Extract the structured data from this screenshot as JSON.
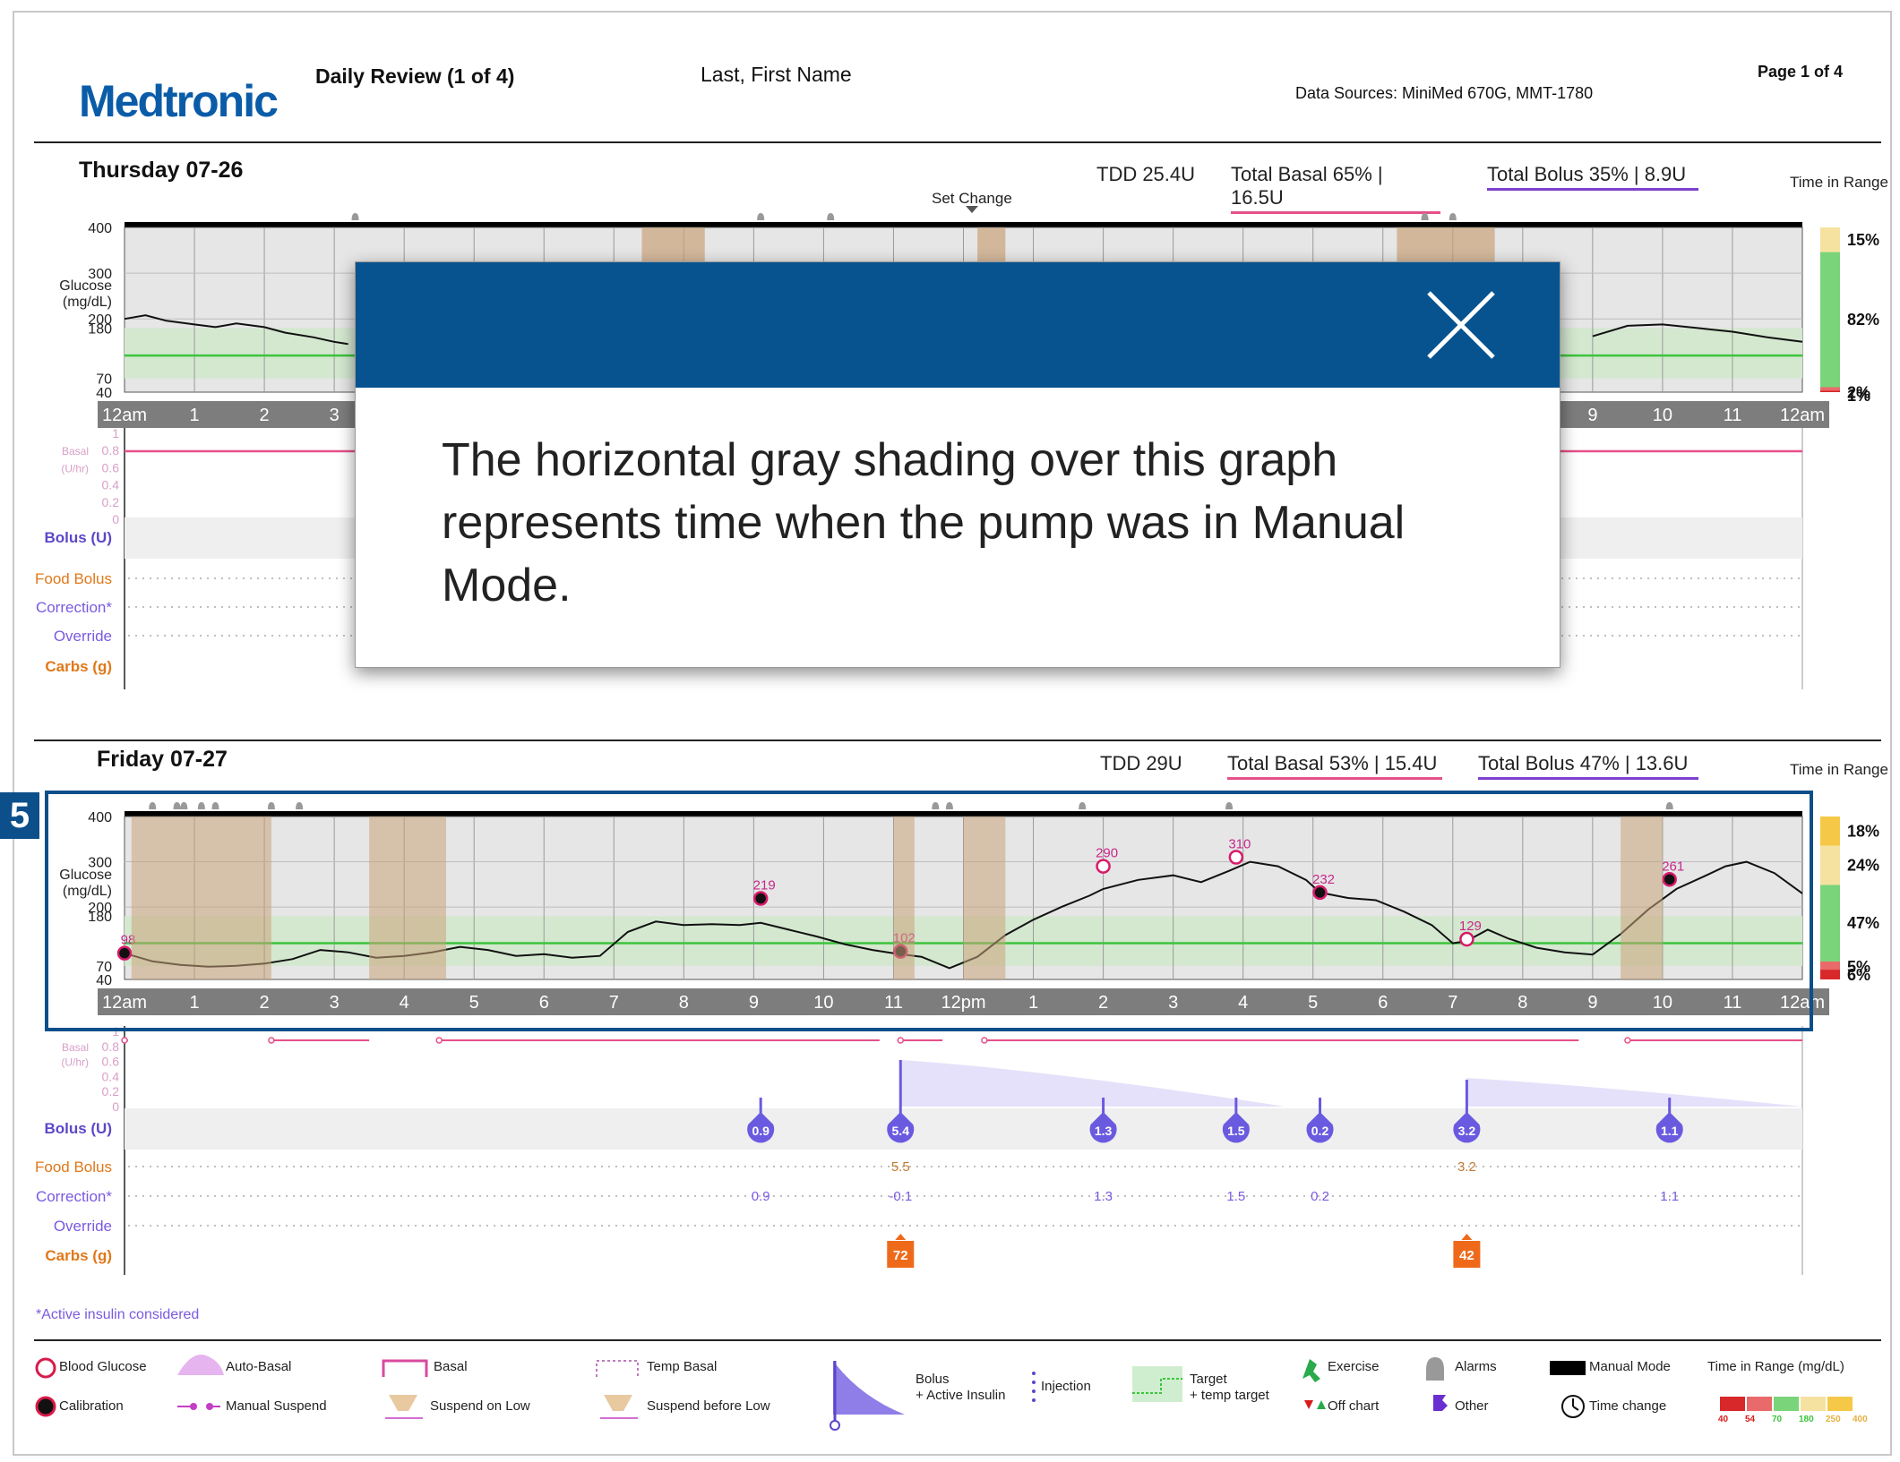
{
  "header": {
    "logo": "Medtronic",
    "report_title": "Daily Review (1 of 4)",
    "patient_name": "Last, First Name",
    "data_sources": "Data Sources: MiniMed 670G, MMT-1780",
    "page_label": "Page 1 of 4"
  },
  "colors": {
    "brand_blue": "#0b5ca8",
    "overlay_blue": "#06538f",
    "basal_pink": "#e6508a",
    "bolus_purple": "#7e5ee0",
    "target_green": "#3cc43c",
    "carbs_orange": "#ee6a1a"
  },
  "tooltip": {
    "text": "The horizontal gray shading over this graph represents time when the pump was in Manual Mode."
  },
  "callout": {
    "number": "5"
  },
  "footnote": "*Active insulin considered",
  "lane_labels": {
    "basal": "Basal",
    "basal_units": "(U/hr)",
    "bolus": "Bolus (U)",
    "food_bolus": "Food Bolus",
    "correction": "Correction*",
    "override": "Override",
    "carbs": "Carbs (g)",
    "glucose": "Glucose",
    "glucose_units": "(mg/dL)",
    "time_in_range": "Time in Range"
  },
  "y_ticks": [
    "400",
    "300",
    "200",
    "180",
    "70",
    "40"
  ],
  "basal_ticks": [
    "1",
    "0.8",
    "0.6",
    "0.4",
    "0.2",
    "0"
  ],
  "x_ticks": [
    "12am",
    "1",
    "2",
    "3",
    "4",
    "5",
    "6",
    "7",
    "8",
    "9",
    "10",
    "11",
    "12pm",
    "1",
    "2",
    "3",
    "4",
    "5",
    "6",
    "7",
    "8",
    "9",
    "10",
    "11",
    "12am"
  ],
  "day1": {
    "title": "Thursday 07-26",
    "tdd": "TDD 25.4U",
    "basal": "Total Basal 65% | 16.5U",
    "bolus": "Total Bolus 35% | 8.9U",
    "set_change": "Set Change",
    "tir": [
      "15%",
      "82%",
      "2%",
      "1%"
    ]
  },
  "day2": {
    "title": "Friday 07-27",
    "tdd": "TDD 29U",
    "basal": "Total Basal 53% | 15.4U",
    "bolus": "Total Bolus 47% | 13.6U",
    "tir": [
      "18%",
      "24%",
      "47%",
      "5%",
      "6%"
    ]
  },
  "legend": {
    "blood_glucose": "Blood Glucose",
    "calibration": "Calibration",
    "auto_basal": "Auto-Basal",
    "manual_suspend": "Manual Suspend",
    "basal": "Basal",
    "suspend_on_low": "Suspend on Low",
    "temp_basal": "Temp Basal",
    "suspend_before_low": "Suspend before Low",
    "bolus": "Bolus",
    "active_insulin": "+ Active Insulin",
    "injection": "Injection",
    "target": "Target",
    "temp_target": "+ temp target",
    "exercise": "Exercise",
    "off_chart": "Off chart",
    "alarms": "Alarms",
    "other": "Other",
    "manual_mode": "Manual Mode",
    "time_change": "Time change",
    "tir_title": "Time in Range (mg/dL)",
    "tir_scale": [
      "40",
      "54",
      "70",
      "180",
      "250",
      "400"
    ]
  },
  "chart_data": [
    {
      "type": "line",
      "title": "Thursday 07-26",
      "xlabel": "",
      "ylabel": "Glucose (mg/dL)",
      "ylim": [
        40,
        400
      ],
      "x_unit": "hour of day",
      "series": [
        {
          "values_x": [
            0,
            0.3,
            0.6,
            1,
            1.3,
            1.6,
            2,
            2.3,
            2.7,
            3,
            3.2
          ],
          "values_y": [
            200,
            208,
            196,
            188,
            182,
            190,
            182,
            170,
            160,
            150,
            145
          ]
        },
        {
          "values_x": [
            21,
            21.5,
            22,
            22.5,
            23,
            23.5,
            24
          ],
          "values_y": [
            162,
            185,
            188,
            180,
            172,
            160,
            150
          ]
        }
      ],
      "target_range": [
        70,
        180
      ],
      "target_line": 120,
      "time_in_range": [
        {
          "label": "15%",
          "value": 15
        },
        {
          "label": "82%",
          "value": 82
        },
        {
          "label": "2%",
          "value": 2
        },
        {
          "label": "1%",
          "value": 1
        }
      ]
    },
    {
      "type": "line",
      "title": "Friday 07-27",
      "xlabel": "",
      "ylabel": "Glucose (mg/dL)",
      "ylim": [
        40,
        400
      ],
      "x_unit": "hour of day",
      "series": [
        {
          "values_x": [
            0,
            0.4,
            0.8,
            1.2,
            1.6,
            2,
            2.4,
            2.8,
            3.2,
            3.6,
            4,
            4.4,
            4.8,
            5.2,
            5.6,
            6,
            6.4,
            6.8,
            7.2,
            7.6,
            8,
            8.4,
            8.8,
            9.1,
            9.5,
            9.9,
            10.3,
            10.7,
            11,
            11.4,
            11.8,
            12.2,
            12.6,
            13,
            13.4,
            13.8,
            14,
            14.5,
            15,
            15.4,
            15.8,
            16.1,
            16.5,
            16.9,
            17.1,
            17.5,
            17.9,
            18.3,
            18.7,
            19,
            19.2,
            19.5,
            19.8,
            20.2,
            20.6,
            21,
            21.4,
            21.8,
            22.2,
            22.6,
            22.9,
            23.2,
            23.6,
            24
          ],
          "values_y": [
            98,
            80,
            72,
            68,
            70,
            75,
            85,
            105,
            100,
            88,
            92,
            100,
            112,
            105,
            92,
            96,
            88,
            92,
            145,
            168,
            160,
            162,
            160,
            165,
            150,
            135,
            118,
            105,
            98,
            90,
            65,
            90,
            138,
            172,
            200,
            225,
            240,
            260,
            270,
            255,
            280,
            300,
            290,
            260,
            232,
            220,
            215,
            190,
            160,
            120,
            125,
            150,
            130,
            110,
            100,
            95,
            140,
            195,
            240,
            268,
            290,
            300,
            275,
            230
          ]
        }
      ],
      "target_range": [
        70,
        180
      ],
      "target_line": 120,
      "bg_markers": [
        {
          "x": 0.0,
          "y": 98,
          "label": "98",
          "kind": "calibration"
        },
        {
          "x": 9.1,
          "y": 219,
          "label": "219",
          "kind": "calibration"
        },
        {
          "x": 11.1,
          "y": 102,
          "label": "102",
          "kind": "calibration"
        },
        {
          "x": 14.0,
          "y": 290,
          "label": "290",
          "kind": "blood-glucose"
        },
        {
          "x": 15.9,
          "y": 310,
          "label": "310",
          "kind": "blood-glucose"
        },
        {
          "x": 17.1,
          "y": 232,
          "label": "232",
          "kind": "calibration"
        },
        {
          "x": 19.2,
          "y": 129,
          "label": "129",
          "kind": "blood-glucose"
        },
        {
          "x": 22.1,
          "y": 261,
          "label": "261",
          "kind": "calibration"
        }
      ],
      "bolus": [
        {
          "x": 9.1,
          "total": "0.9",
          "food": "",
          "correction": "0.9"
        },
        {
          "x": 11.1,
          "total": "5.4",
          "food": "5.5",
          "correction": "-0.1"
        },
        {
          "x": 14.0,
          "total": "1.3",
          "food": "",
          "correction": "1.3"
        },
        {
          "x": 15.9,
          "total": "1.5",
          "food": "",
          "correction": "1.5"
        },
        {
          "x": 17.1,
          "total": "0.2",
          "food": "",
          "correction": "0.2"
        },
        {
          "x": 19.2,
          "total": "3.2",
          "food": "3.2",
          "correction": ""
        },
        {
          "x": 22.1,
          "total": "1.1",
          "food": "",
          "correction": "1.1"
        }
      ],
      "carbs": [
        {
          "x": 11.1,
          "value": "72"
        },
        {
          "x": 19.2,
          "value": "42"
        }
      ],
      "time_in_range": [
        {
          "label": "18%",
          "value": 18
        },
        {
          "label": "24%",
          "value": 24
        },
        {
          "label": "47%",
          "value": 47
        },
        {
          "label": "5%",
          "value": 5
        },
        {
          "label": "6%",
          "value": 6
        }
      ]
    }
  ]
}
